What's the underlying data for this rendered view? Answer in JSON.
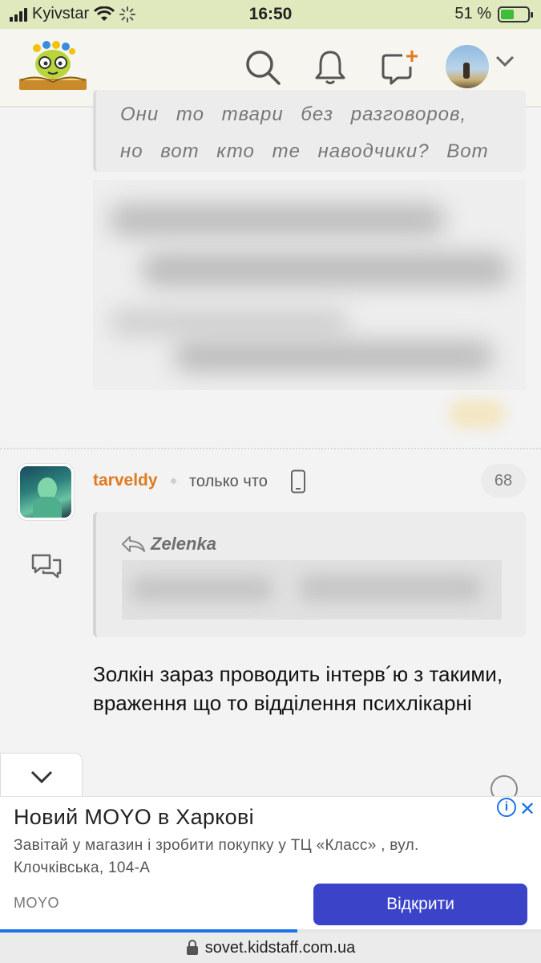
{
  "status_bar": {
    "carrier": "Kyivstar",
    "time": "16:50",
    "battery": "51 %",
    "battery_level": 0.51
  },
  "header": {
    "icons": [
      "search-icon",
      "bell-icon",
      "new-message-icon",
      "avatar",
      "chevron-down-icon"
    ],
    "colors": {
      "background": "#f6f5ef",
      "accent": "#e07a1f"
    }
  },
  "previous_post": {
    "quote_text": "Они то твари без разговоров, но вот кто те наводчики? Вот бл.и. кт"
  },
  "post": {
    "author": "tarveldy",
    "time": "только что",
    "number": "68",
    "quote_author": "Zelenka",
    "body": "Золкін зараз проводить інтерв´ю з такими, враження що то відділення психлікарні"
  },
  "ad": {
    "title": "Новий MOYO в Харкові",
    "text": "Завітай у магазин і зробити покупку у ТЦ «Класс» , вул. Клочківська, 104-А",
    "brand": "MOYO",
    "button_label": "Відкрити",
    "progress": 0.55,
    "button_color": "#3b43c9"
  },
  "url_bar": {
    "url": "sovet.kidstaff.com.ua"
  }
}
